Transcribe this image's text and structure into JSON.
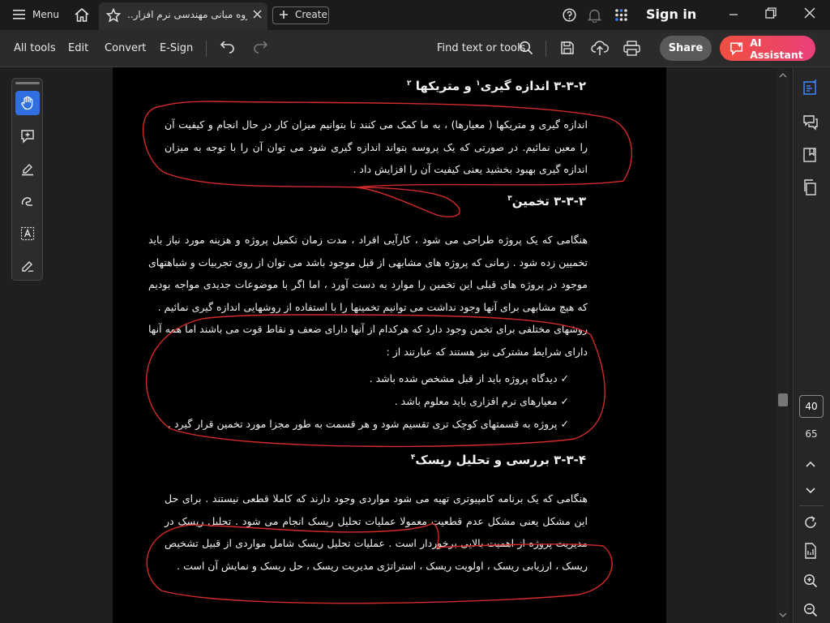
{
  "titlebar": {
    "menu_label": "Menu",
    "tab_title": "جزوه مبانی مهندسی نرم افزار..",
    "create_label": "Create",
    "sign_in": "Sign in"
  },
  "toolbar": {
    "all_tools": "All tools",
    "edit": "Edit",
    "convert": "Convert",
    "esign": "E-Sign",
    "find": "Find text or tools",
    "share": "Share",
    "ai_assistant": "AI Assistant"
  },
  "document": {
    "h1_number": "۳-۳-۲",
    "h1_text": "اندازه گیری",
    "h1_sup1": "۱",
    "h1_text2": "و متریکها",
    "h1_sup2": "۲",
    "p1": "اندازه گیری و متریکها ( معیارها) ، به ما کمک می کنند تا بتوانیم میزان کار در حال انجام و کیفیت آن را معین نمائیم. در صورتی که یک پروسه بتواند اندازه گیری شود می توان آن را با توجه به میزان اندازه گیری بهبود بخشید یعنی کیفیت آن را افزایش داد .",
    "h2_number": "۳-۳-۳",
    "h2_text": "تخمین",
    "h2_sup": "۳",
    "p2": "هنگامی که یک پروژه طراحی می شود ، کارآیی افراد ، مدت زمان تکمیل پروژه و هزینه مورد نیاز باید تخمیین زده شود . زمانی که پروژه های مشابهی از قبل موجود باشد می توان از روی تجربیات و شباهتهای موجود در پروژه های قبلی این تخمین را موارد به دست آورد ، اما اگر با موضوعات جدیدی مواجه بودیم که هیچ مشابهی برای آنها وجود نداشت می توانیم تخمینها را با استفاده از روشهایی اندازه گیری نمائیم .",
    "p3": "روشهای مختلفی برای تخمن وجود دارد که هرکدام از آنها دارای ضعف و نقاط قوت می باشند اما همه آنها دارای شرایط مشترکی نیز هستند که عبارتند از :",
    "bullets": [
      "دیدگاه پروژه باید از قبل مشخص شده باشد .",
      "معیارهای نرم افزاری باید معلوم باشد .",
      "پروژه به قسمتهای کوچک تری تقسیم شود و هر قسمت به طور مجزا مورد تخمین قرار گیرد ."
    ],
    "h3_number": "۳-۳-۴",
    "h3_text": "بررسی و تحلیل ریسک",
    "h3_sup": "۴",
    "p4": "هنگامی که یک برنامه کامپیوتری تهیه می شود مواردی وجود دارند که کاملا قطعی نیستند . برای حل این مشکل یعنی مشکل عدم قطعیت معمولا عملیات تحلیل ریسک انجام می شود . تحلیل ریسک در مدیریت پروژه از اهمیت بالایی برخوردار است . عملیات تحلیل ریسک شامل مواردی از قبیل تشخیص ریسک ، ارزیابی ریسک ، اولویت ریسک ، استراتژی مدیریت ریسک ، حل ریسک و نمایش آن است ."
  },
  "pager": {
    "current": "40",
    "total": "65"
  },
  "colors": {
    "annotation_ink": "#d42a2a",
    "ai_gradient_start": "#f04f3f",
    "ai_gradient_end": "#e9407a",
    "active_tool": "#2f6fe0"
  },
  "icons": {
    "check": "✓"
  }
}
